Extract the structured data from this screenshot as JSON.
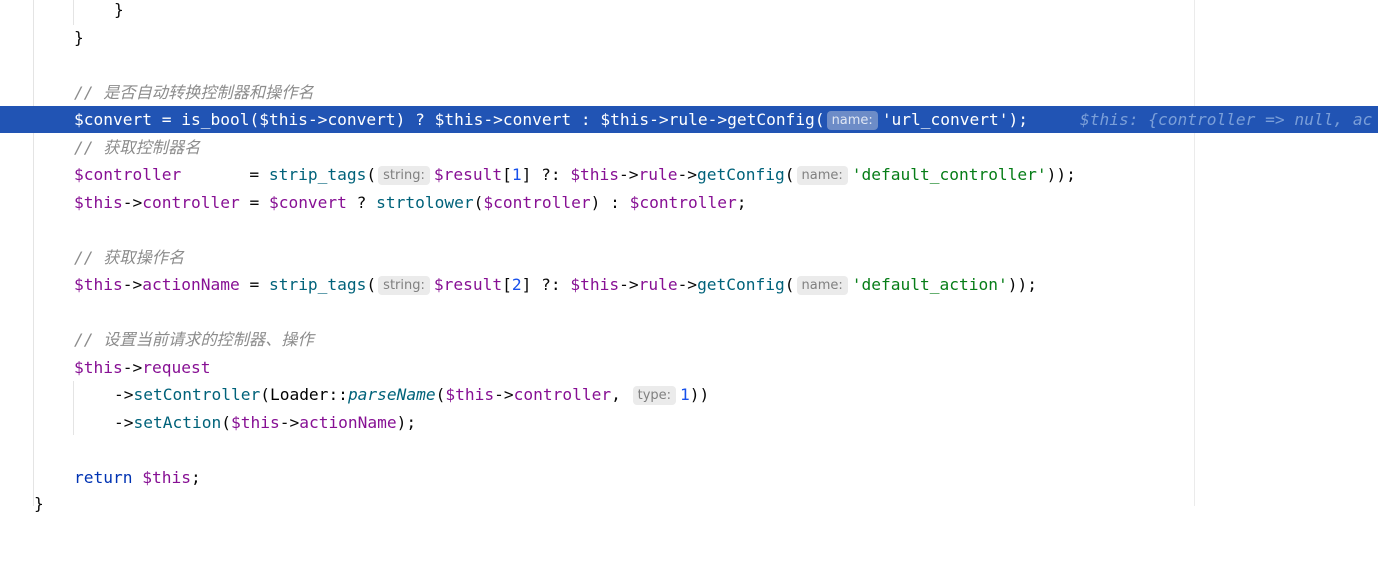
{
  "code": {
    "brace_inner": "}",
    "brace_outer": "}",
    "comment_convert": "// 是否自动转换控制器和操作名",
    "convert_line": {
      "var": "$convert",
      "eq": " = ",
      "fn": "is_bool",
      "p1": "(",
      "this1": "$this",
      "arrow1": "->",
      "prop1": "convert",
      "p2": ") ? ",
      "this2": "$this",
      "arrow2": "->",
      "prop2": "convert",
      "colon": " : ",
      "this3": "$this",
      "arrow3": "->",
      "prop3": "rule",
      "arrow4": "->",
      "fn2": "getConfig",
      "p3": "(",
      "hint": "name:",
      "str": "'url_convert'",
      "end": ");",
      "debug": "$this: {controller => null, ac"
    },
    "comment_controller": "// 获取控制器名",
    "controller_line": {
      "var": "$controller",
      "eq": "       = ",
      "fn": "strip_tags",
      "p1": "(",
      "hint1": "string:",
      "result": "$result",
      "idx_open": "[",
      "idx": "1",
      "idx_close": "] ?: ",
      "this1": "$this",
      "arrow1": "->",
      "prop1": "rule",
      "arrow2": "->",
      "fn2": "getConfig",
      "p2": "(",
      "hint2": "name:",
      "str": "'default_controller'",
      "end": "));"
    },
    "this_controller_line": {
      "this1": "$this",
      "arrow1": "->",
      "prop1": "controller",
      "eq": " = ",
      "var1": "$convert",
      "q": " ? ",
      "fn": "strtolower",
      "p1": "(",
      "var2": "$controller",
      "p2": ") : ",
      "var3": "$controller",
      "end": ";"
    },
    "comment_action": "// 获取操作名",
    "action_line": {
      "this1": "$this",
      "arrow1": "->",
      "prop1": "actionName",
      "eq": " = ",
      "fn": "strip_tags",
      "p1": "(",
      "hint1": "string:",
      "result": "$result",
      "idx_open": "[",
      "idx": "2",
      "idx_close": "] ?: ",
      "this2": "$this",
      "arrow2": "->",
      "prop2": "rule",
      "arrow3": "->",
      "fn2": "getConfig",
      "p2": "(",
      "hint2": "name:",
      "str": "'default_action'",
      "end": "));"
    },
    "comment_request": "// 设置当前请求的控制器、操作",
    "request_line": {
      "this1": "$this",
      "arrow1": "->",
      "prop1": "request"
    },
    "set_controller_line": {
      "arrow1": "->",
      "fn": "setController",
      "p1": "(",
      "cls": "Loader",
      "dc": "::",
      "static": "parseName",
      "p2": "(",
      "this1": "$this",
      "arrow2": "->",
      "prop1": "controller",
      "comma": ", ",
      "hint": "type:",
      "num": "1",
      "end": "))"
    },
    "set_action_line": {
      "arrow1": "->",
      "fn": "setAction",
      "p1": "(",
      "this1": "$this",
      "arrow2": "->",
      "prop1": "actionName",
      "end": ");"
    },
    "return_line": {
      "kw": "return",
      "sp": " ",
      "this1": "$this",
      "end": ";"
    },
    "brace_fn": "}"
  }
}
